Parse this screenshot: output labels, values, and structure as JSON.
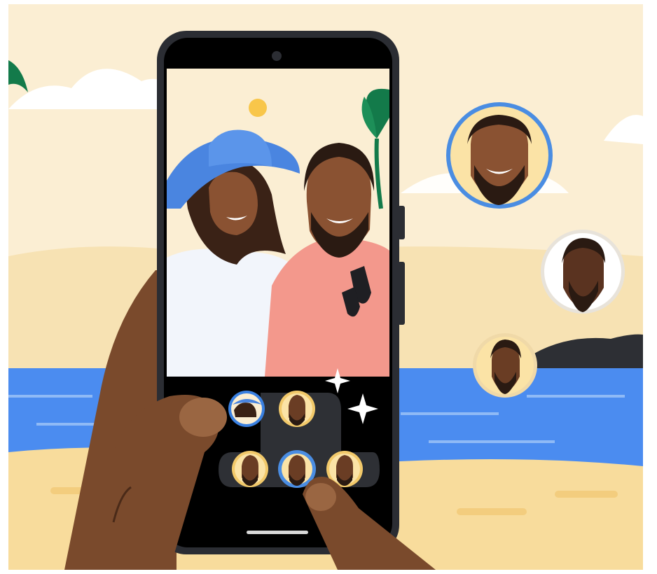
{
  "scene": {
    "palette": {
      "sky": "#fbeed3",
      "sand": "#f8dc9c",
      "sea": "#4b8cf0",
      "phone_body": "#2b2d33",
      "skin": "#7a4a2c",
      "accent_ring": "#4a8de2"
    },
    "icons": [
      "sparkle-icon",
      "face-option-avatar",
      "home-indicator"
    ]
  }
}
